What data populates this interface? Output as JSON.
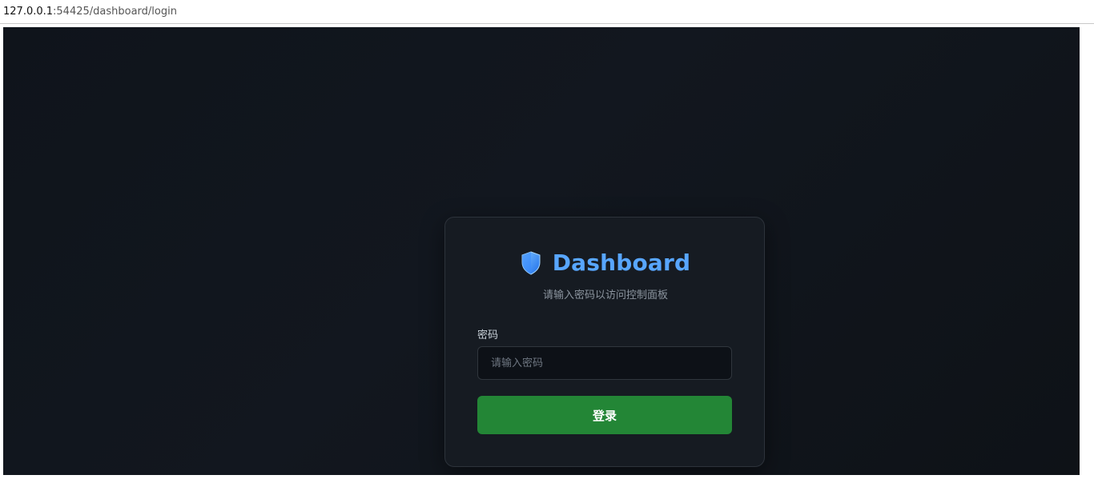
{
  "browser": {
    "url_host": "127.0.0.1",
    "url_rest": ":54425/dashboard/login"
  },
  "login": {
    "icon": "shield-icon",
    "title": "Dashboard",
    "subtitle": "请输入密码以访问控制面板",
    "password_label": "密码",
    "password_placeholder": "请输入密码",
    "password_value": "",
    "submit_label": "登录"
  },
  "colors": {
    "accent": "#58a6ff",
    "button": "#238636",
    "card_bg": "#161b22",
    "page_bg": "#0f141b"
  }
}
